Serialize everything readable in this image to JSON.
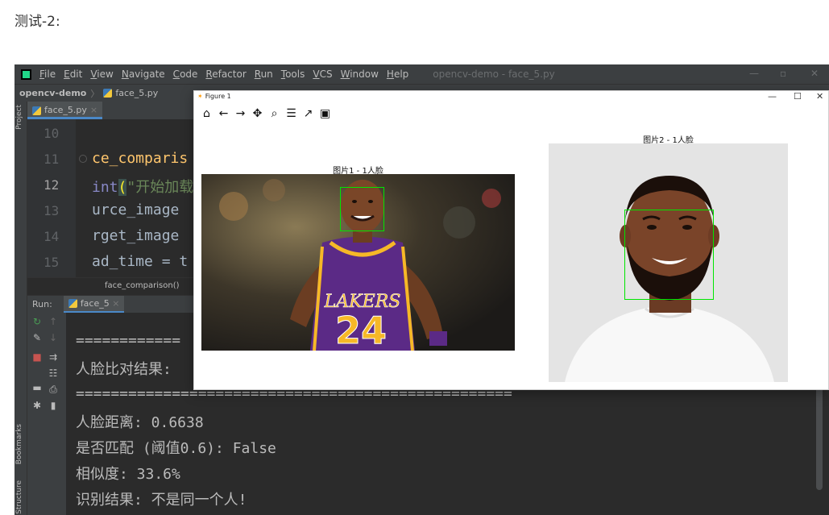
{
  "page": {
    "heading": "测试-2:"
  },
  "ide": {
    "menu": [
      "File",
      "Edit",
      "View",
      "Navigate",
      "Code",
      "Refactor",
      "Run",
      "Tools",
      "VCS",
      "Window",
      "Help"
    ],
    "window_title": "opencv-demo - face_5.py",
    "project_name": "opencv-demo",
    "file_name": "face_5.py",
    "tab_name": "face_5.py",
    "side_labels": {
      "project": "Project",
      "bookmarks": "Bookmarks",
      "structure": "Structure"
    },
    "code": {
      "line_numbers": [
        "10",
        "11",
        "12",
        "13",
        "14",
        "15"
      ],
      "line_11": "ce_comparis",
      "line_12_fn": "int",
      "line_12_str": "\"开始加载",
      "line_13": "urce_image",
      "line_14": "rget_image",
      "line_15": "ad_time = t"
    },
    "breadcrumb": "face_comparison()",
    "run": {
      "label": "Run:",
      "tab": "face_5"
    },
    "console": {
      "line_1": "============",
      "line_2": "人脸比对结果:",
      "line_3": "==================================================",
      "line_4": "人脸距离: 0.6638",
      "line_5": "是否匹配 (阈值0.6): False",
      "line_6": "相似度: 33.6%",
      "line_7": "识别结果: 不是同一个人!"
    }
  },
  "figure": {
    "title": "Figure 1",
    "toolbar_icons": [
      "home-icon",
      "back-icon",
      "forward-icon",
      "pan-icon",
      "zoom-icon",
      "configure-icon",
      "edit-curve-icon",
      "save-icon"
    ],
    "image1_title": "图片1 - 1人脸",
    "image2_title": "图片2 - 1人脸",
    "jersey_text": "LAKERS",
    "jersey_number": "24",
    "face_box_color": "#00e600"
  }
}
